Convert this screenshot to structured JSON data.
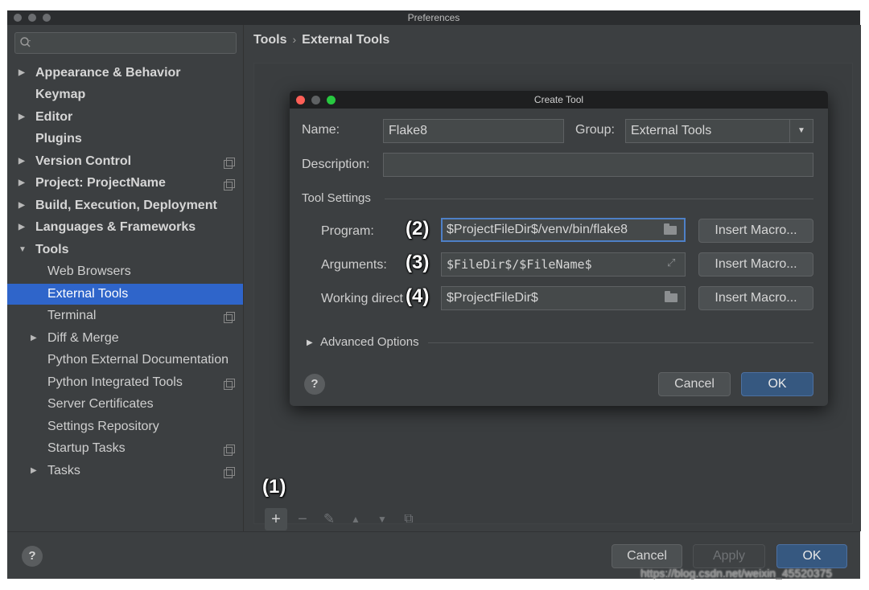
{
  "window": {
    "title": "Preferences"
  },
  "sidebar": {
    "items": [
      {
        "label": "Appearance & Behavior"
      },
      {
        "label": "Keymap"
      },
      {
        "label": "Editor"
      },
      {
        "label": "Plugins"
      },
      {
        "label": "Version Control"
      },
      {
        "label": "Project: ProjectName"
      },
      {
        "label": "Build, Execution, Deployment"
      },
      {
        "label": "Languages & Frameworks"
      },
      {
        "label": "Tools"
      },
      {
        "label": "Web Browsers"
      },
      {
        "label": "External Tools"
      },
      {
        "label": "Terminal"
      },
      {
        "label": "Diff & Merge"
      },
      {
        "label": "Python External Documentation"
      },
      {
        "label": "Python Integrated Tools"
      },
      {
        "label": "Server Certificates"
      },
      {
        "label": "Settings Repository"
      },
      {
        "label": "Startup Tasks"
      },
      {
        "label": "Tasks"
      }
    ]
  },
  "main": {
    "breadcrumb": {
      "root": "Tools",
      "separator": "›",
      "current": "External Tools"
    },
    "toolbar": {
      "add": "+",
      "remove": "−",
      "edit": "✎",
      "up": "▲",
      "down": "▼",
      "copy": "⧉"
    },
    "annotation_1": "(1)"
  },
  "dialog": {
    "title": "Create Tool",
    "name_label": "Name:",
    "name_value": "Flake8",
    "group_label": "Group:",
    "group_value": "External Tools",
    "description_label": "Description:",
    "description_value": "",
    "tool_settings_label": "Tool Settings",
    "program_label": "Program:",
    "program_value": "$ProjectFileDir$/venv/bin/flake8",
    "arguments_label": "Arguments:",
    "arguments_value": "$FileDir$/$FileName$",
    "working_dir_label": "Working direct",
    "working_dir_value": "$ProjectFileDir$",
    "insert_macro_label": "Insert Macro...",
    "advanced_options_label": "Advanced Options",
    "help_label": "?",
    "cancel_label": "Cancel",
    "ok_label": "OK",
    "annotation_2": "(2)",
    "annotation_3": "(3)",
    "annotation_4": "(4)"
  },
  "footer": {
    "help_label": "?",
    "cancel_label": "Cancel",
    "apply_label": "Apply",
    "ok_label": "OK"
  },
  "watermark": "https://blog.csdn.net/weixin_45520375",
  "colors": {
    "background": "#3c3f41",
    "selection": "#2f65ca",
    "primary_button": "#365880",
    "focus_border": "#4e80c7",
    "traffic_close": "#ff5f57",
    "traffic_minimize": "#febc2e",
    "traffic_zoom": "#28c840"
  }
}
